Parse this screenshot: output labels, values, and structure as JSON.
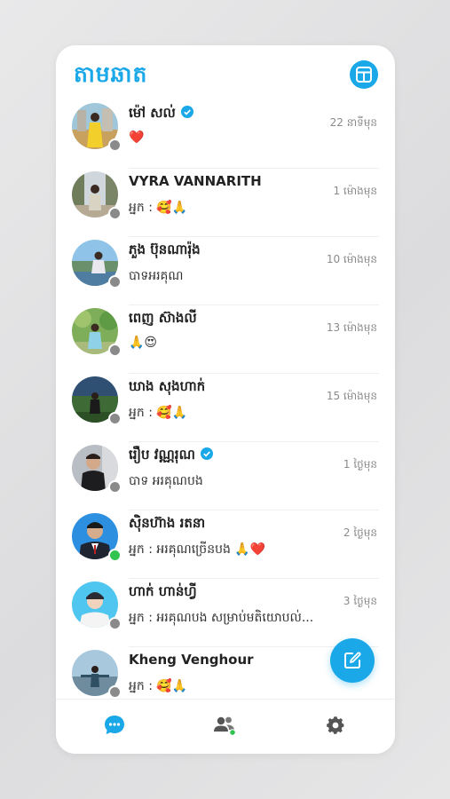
{
  "app": {
    "title": "តាមឆាត"
  },
  "chats": [
    {
      "name": "ម៉ៅ សល់",
      "verified": true,
      "preview": "❤️",
      "time": "22 នាទីមុន",
      "online": false
    },
    {
      "name": "VYRA VANNARITH",
      "verified": false,
      "preview": "អ្នក : 🥰🙏",
      "time": "1 ម៉ោងមុន",
      "online": false
    },
    {
      "name": "ភួង ប៊ុនណារ៉ុង",
      "verified": false,
      "preview": "បាទអរគុណ",
      "time": "10 ម៉ោងមុន",
      "online": false
    },
    {
      "name": "ពេញ ស៊ាងលី",
      "verified": false,
      "preview": "🙏😍",
      "time": "13 ម៉ោងមុន",
      "online": false
    },
    {
      "name": "ឃាង សុងហាក់",
      "verified": false,
      "preview": "អ្នក : 🥰🙏",
      "time": "15 ម៉ោងមុន",
      "online": false
    },
    {
      "name": "រឿប វណ្ណរុណ",
      "verified": true,
      "preview": "បាទ អរគុណបង",
      "time": "1 ថ្ងៃមុន",
      "online": false
    },
    {
      "name": "ស៊ិនហ៊ាង រតនា",
      "verified": false,
      "preview": "អ្នក : អរគុណច្រើនបង 🙏❤️",
      "time": "2 ថ្ងៃមុន",
      "online": true
    },
    {
      "name": "ហាក់ ហាន់ហ្វី",
      "verified": false,
      "preview": "អ្នក : អរគុណបង សម្រាប់មតិយោបល់...",
      "time": "3 ថ្ងៃមុន",
      "online": false
    },
    {
      "name": "Kheng Venghour",
      "verified": false,
      "preview": "អ្នក : 🥰🙏",
      "time": "",
      "online": false
    }
  ],
  "icons": {
    "layout": "layout-grid-icon",
    "compose": "compose-icon",
    "chats_tab": "chat-bubble-icon",
    "contacts_tab": "people-icon",
    "settings_tab": "gear-icon",
    "verified": "verified-badge-icon"
  },
  "colors": {
    "accent": "#1ba8e8",
    "online": "#31c451",
    "offline": "#8a8a8a"
  }
}
